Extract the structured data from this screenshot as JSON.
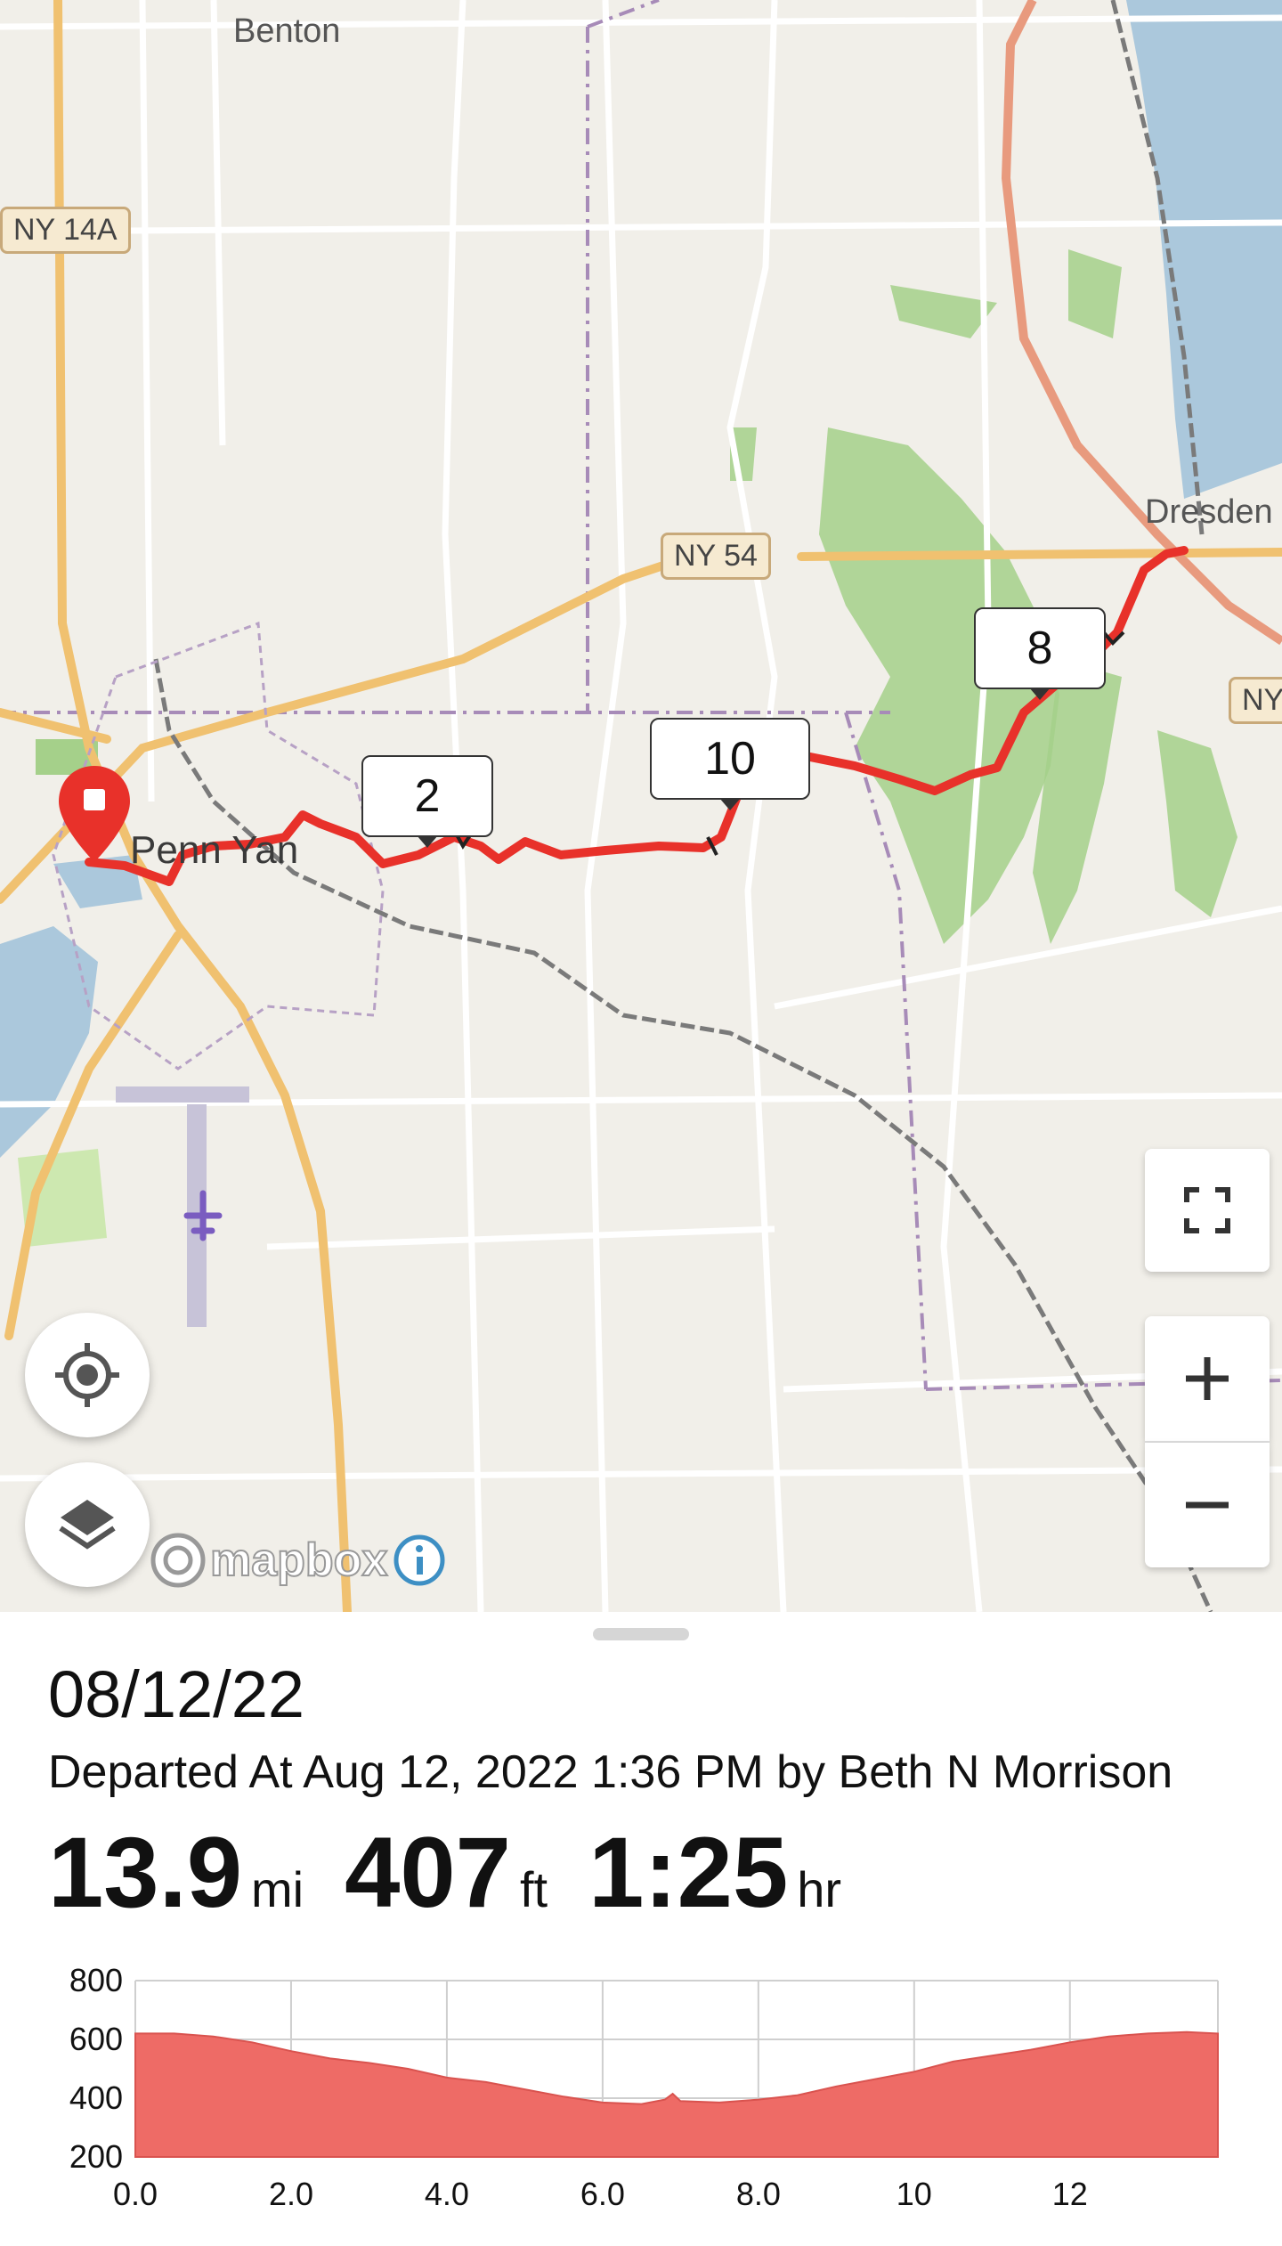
{
  "map": {
    "place_labels": [
      "Benton",
      "Penn Yan",
      "Dresden"
    ],
    "road_shields": [
      "NY 14A",
      "NY 54",
      "NY"
    ],
    "mile_markers": [
      "2",
      "10",
      "8"
    ],
    "attribution": "mapbox",
    "colors": {
      "route": "#e8312a",
      "land": "#f1efe9",
      "water": "#abc8dc",
      "forest": "#a5d08a",
      "major_road": "#f0c170",
      "highway": "#e89a7e"
    }
  },
  "controls": {
    "locate_icon": "crosshair-icon",
    "layers_icon": "layers-icon",
    "fullscreen_icon": "fullscreen-icon",
    "zoom_in_icon": "plus-icon",
    "zoom_out_icon": "minus-icon",
    "info_icon": "info-icon"
  },
  "trip": {
    "date": "08/12/22",
    "departed": "Departed At Aug 12, 2022 1:36 PM by Beth N Morrison",
    "distance": "13.9",
    "distance_unit": "mi",
    "elevation_gain": "407",
    "elevation_unit": "ft",
    "duration": "1:25",
    "duration_unit": "hr"
  },
  "chart_data": {
    "type": "area",
    "title": "",
    "xlabel": "",
    "ylabel": "",
    "xlim": [
      0,
      13.9
    ],
    "ylim": [
      200,
      800
    ],
    "x_ticks": [
      "0.0",
      "2.0",
      "4.0",
      "6.0",
      "8.0",
      "10",
      "12"
    ],
    "y_ticks": [
      "800",
      "600",
      "400",
      "200"
    ],
    "grid": true,
    "color": "#ee6b66",
    "x": [
      0,
      0.5,
      1.0,
      1.5,
      2.0,
      2.5,
      3.0,
      3.5,
      4.0,
      4.5,
      5.0,
      5.5,
      6.0,
      6.5,
      6.8,
      6.9,
      7.0,
      7.5,
      8.0,
      8.5,
      9.0,
      9.5,
      10.0,
      10.5,
      11.0,
      11.5,
      12.0,
      12.5,
      13.0,
      13.5,
      13.9
    ],
    "values": [
      620,
      620,
      610,
      590,
      560,
      535,
      520,
      500,
      470,
      455,
      430,
      405,
      385,
      380,
      395,
      415,
      390,
      385,
      395,
      410,
      440,
      465,
      490,
      525,
      545,
      565,
      590,
      610,
      620,
      625,
      620
    ]
  }
}
